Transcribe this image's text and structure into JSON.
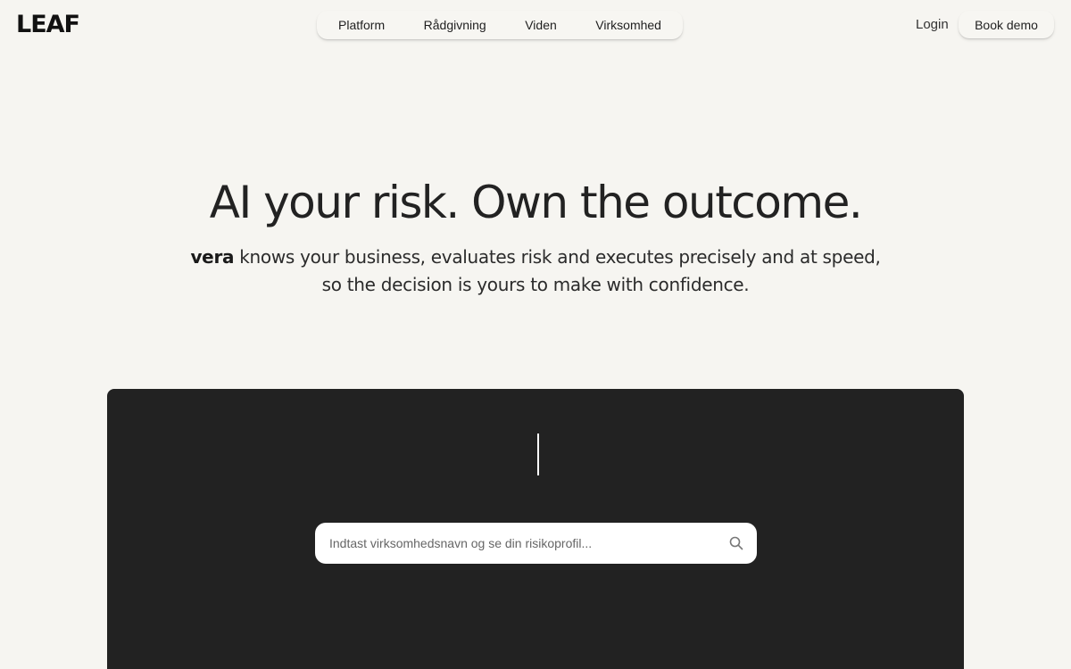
{
  "header": {
    "logo": "LEAF",
    "nav": [
      {
        "label": "Platform"
      },
      {
        "label": "Rådgivning"
      },
      {
        "label": "Viden"
      },
      {
        "label": "Virksomhed"
      }
    ],
    "login_label": "Login",
    "book_demo_label": "Book demo"
  },
  "hero": {
    "title": "AI your risk. Own the outcome.",
    "subtitle_brand": "vera",
    "subtitle_line1": " knows your business, evaluates risk and executes precisely and at speed,",
    "subtitle_line2": "so the decision is yours to make with confidence."
  },
  "demo": {
    "search_placeholder": "Indtast virksomhedsnavn og se din risikoprofil...",
    "search_value": ""
  },
  "colors": {
    "background": "#f6f5f1",
    "panel": "#222222",
    "text": "#222222"
  }
}
